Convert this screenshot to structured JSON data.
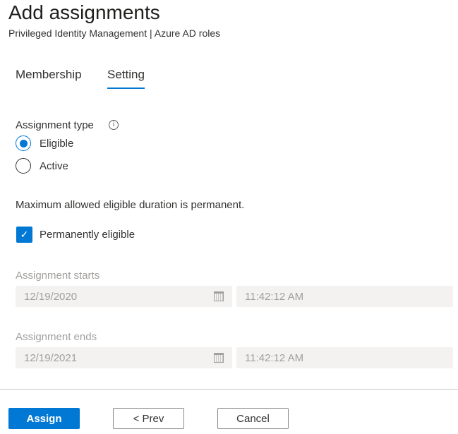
{
  "header": {
    "title": "Add assignments",
    "subtitle": "Privileged Identity Management | Azure AD roles"
  },
  "tabs": [
    {
      "label": "Membership",
      "active": false
    },
    {
      "label": "Setting",
      "active": true
    }
  ],
  "assignment_type": {
    "label": "Assignment type",
    "options": [
      {
        "label": "Eligible",
        "selected": true
      },
      {
        "label": "Active",
        "selected": false
      }
    ]
  },
  "duration_note": "Maximum allowed eligible duration is permanent.",
  "permanent": {
    "label": "Permanently eligible",
    "checked": true
  },
  "starts": {
    "label": "Assignment starts",
    "date": "12/19/2020",
    "time": "11:42:12 AM"
  },
  "ends": {
    "label": "Assignment ends",
    "date": "12/19/2021",
    "time": "11:42:12 AM"
  },
  "buttons": {
    "assign": "Assign",
    "prev": "< Prev",
    "cancel": "Cancel"
  },
  "colors": {
    "accent": "#0078d4"
  }
}
